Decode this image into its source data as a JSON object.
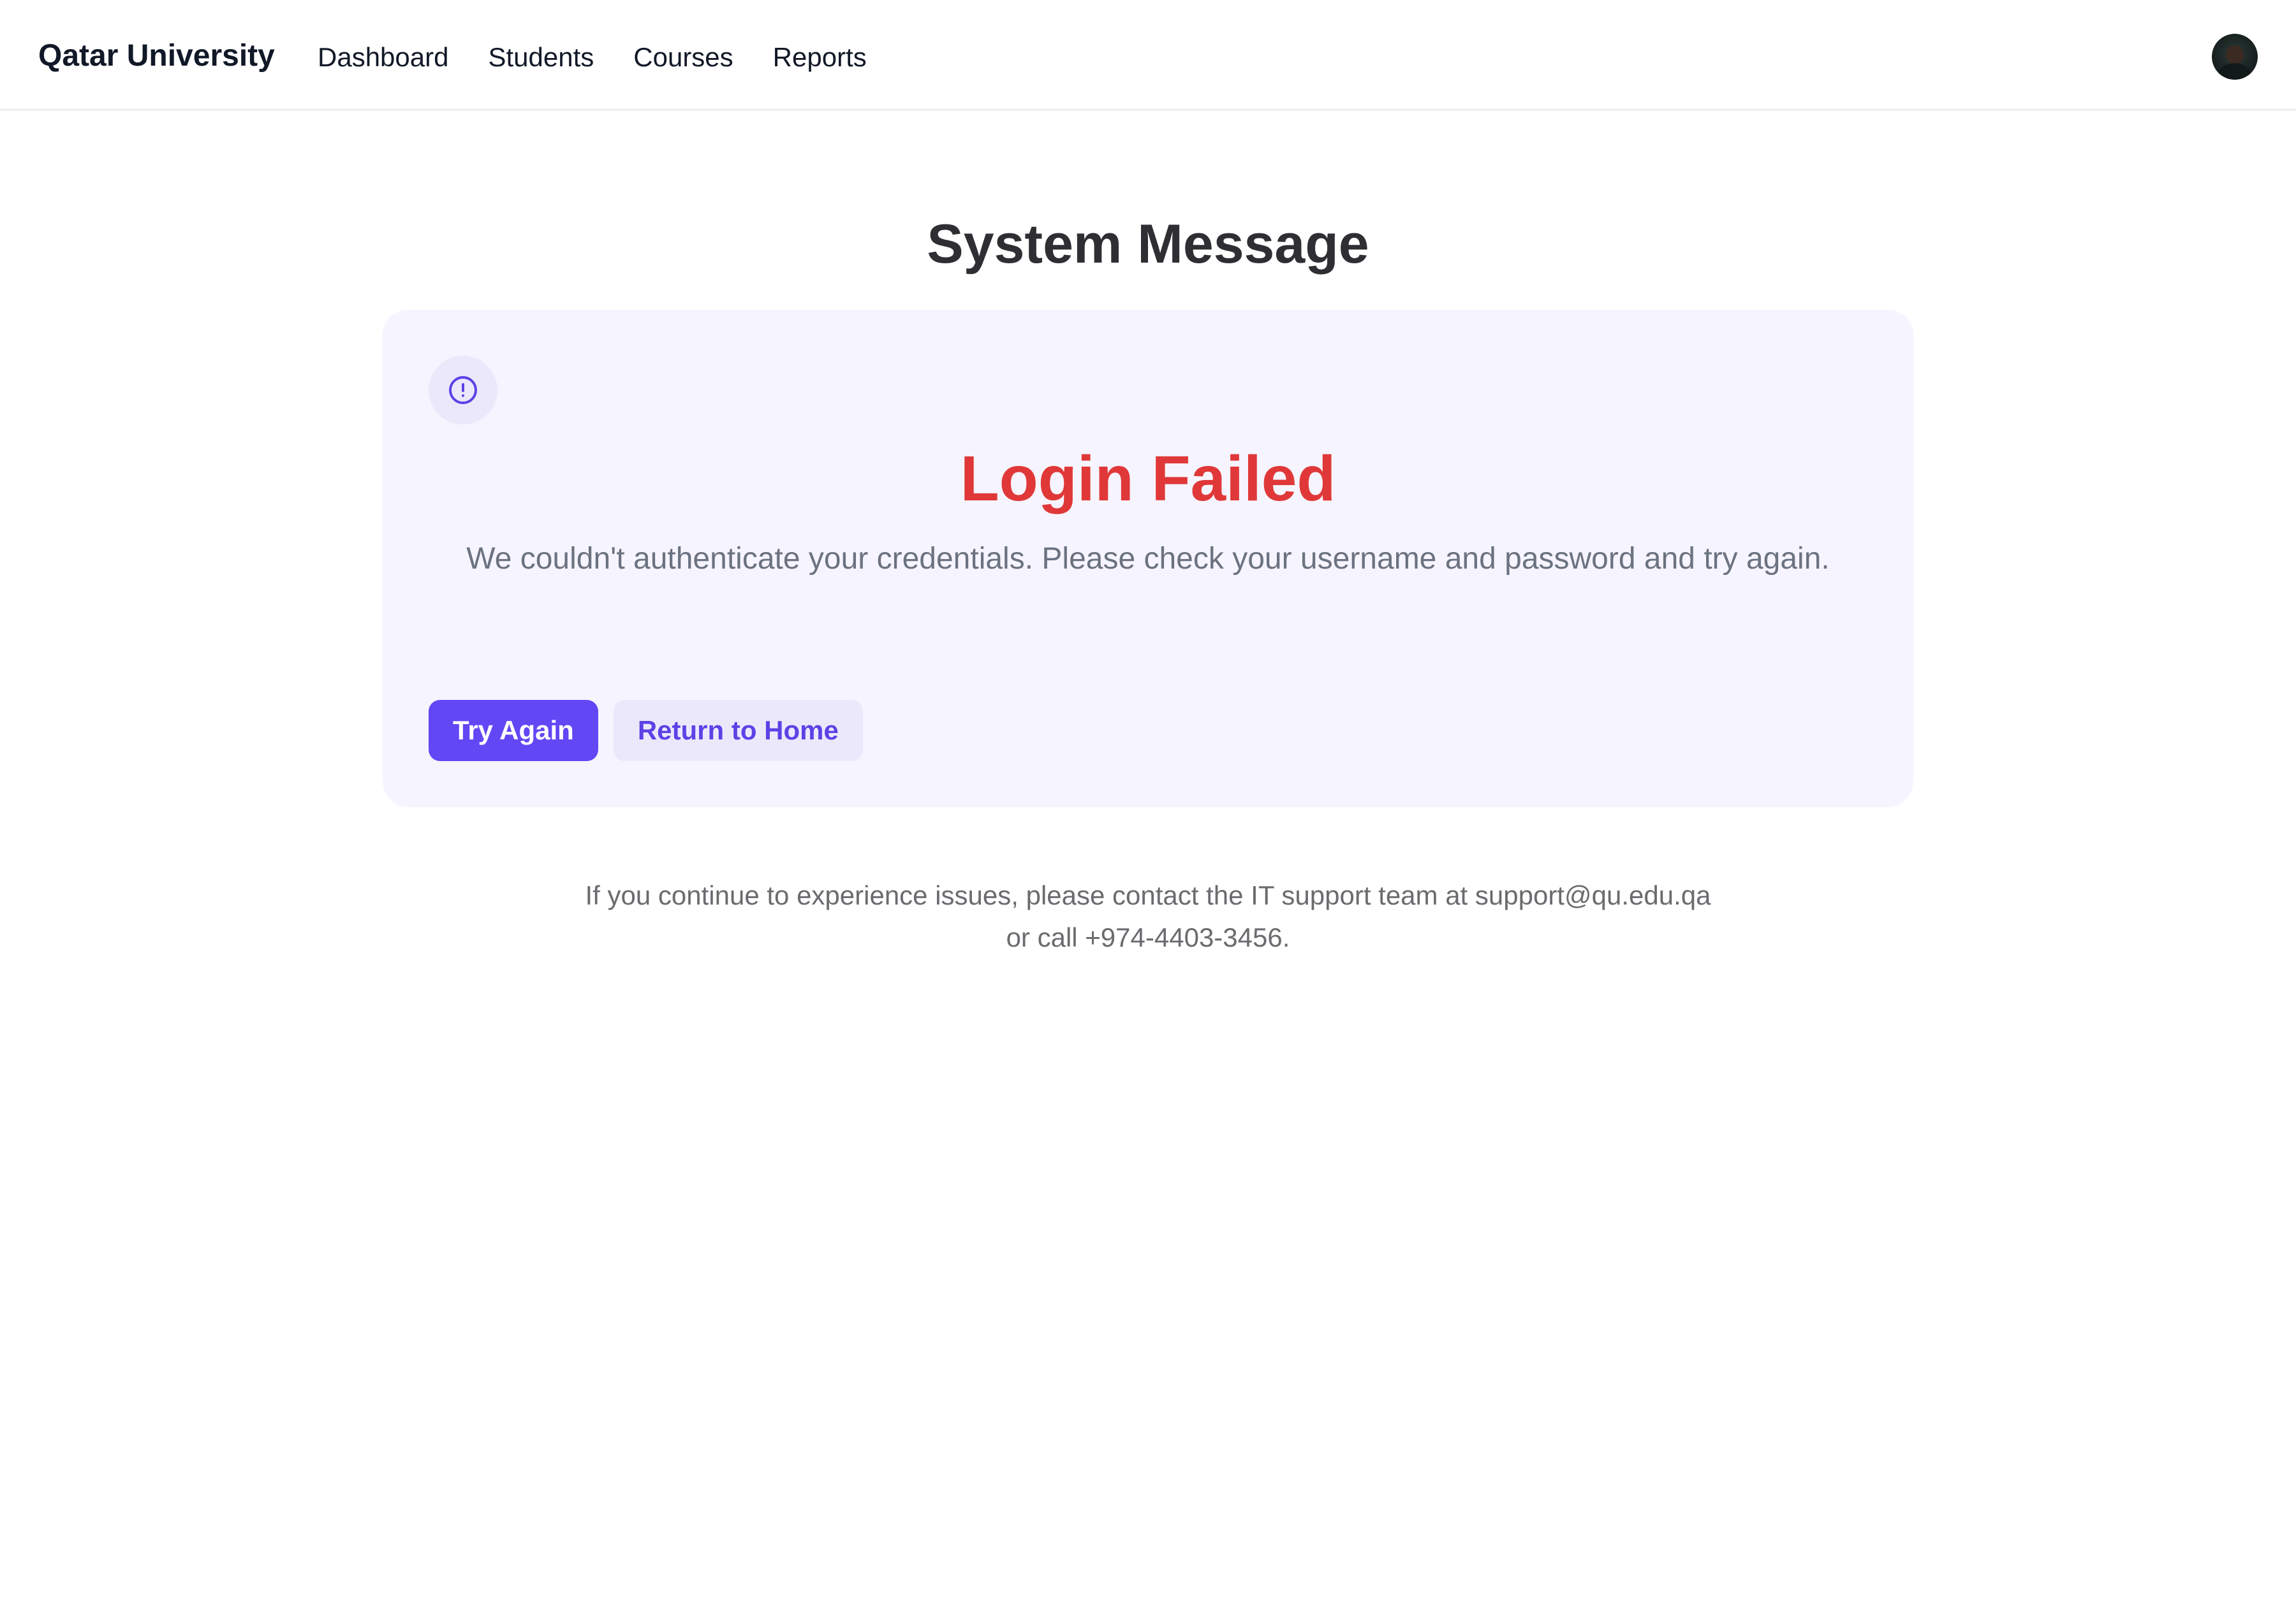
{
  "navbar": {
    "brand": "Qatar University",
    "links": [
      "Dashboard",
      "Students",
      "Courses",
      "Reports"
    ],
    "avatar_icon": "user-avatar"
  },
  "page": {
    "title": "System Message"
  },
  "message_card": {
    "icon": "alert-circle-icon",
    "title": "Login Failed",
    "description": "We couldn't authenticate your credentials. Please check your username and password and try again.",
    "primary_button": "Try Again",
    "secondary_button": "Return to Home"
  },
  "footer": {
    "note": "If you continue to experience issues, please contact the IT support team at support@qu.edu.qa or call +974-4403-3456."
  },
  "colors": {
    "accent": "#6247f5",
    "error": "#e03838",
    "card_background": "#f6f4fe"
  }
}
